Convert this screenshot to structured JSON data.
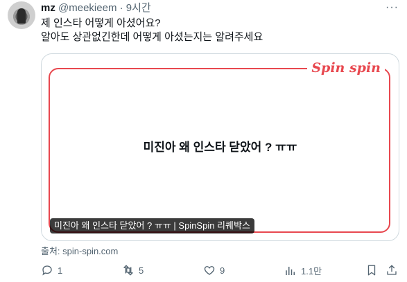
{
  "tweet": {
    "author_name": "mz",
    "handle": "@meekieem",
    "separator": "·",
    "time": "9시간",
    "more": "···",
    "lines": [
      "제 인스타 어떻게 아셨어요?",
      "알아도 상관없긴한데 어떻게 아셨는지는 알려주세요"
    ]
  },
  "card": {
    "logo": "Spin spin",
    "headline": "미진아 왜 인스타 닫았어 ? ㅠㅠ",
    "caption": "미진아 왜 인스타 닫았어 ? ㅠㅠ | SpinSpin 리퀘박스",
    "accent_color": "#e8484f"
  },
  "source": "출처: spin-spin.com",
  "actions": {
    "reply": "1",
    "retweet": "5",
    "like": "9",
    "views": "1.1만"
  },
  "icons": [
    "avatar",
    "more-icon",
    "reply-icon",
    "retweet-icon",
    "like-icon",
    "views-icon",
    "bookmark-icon",
    "share-icon"
  ]
}
